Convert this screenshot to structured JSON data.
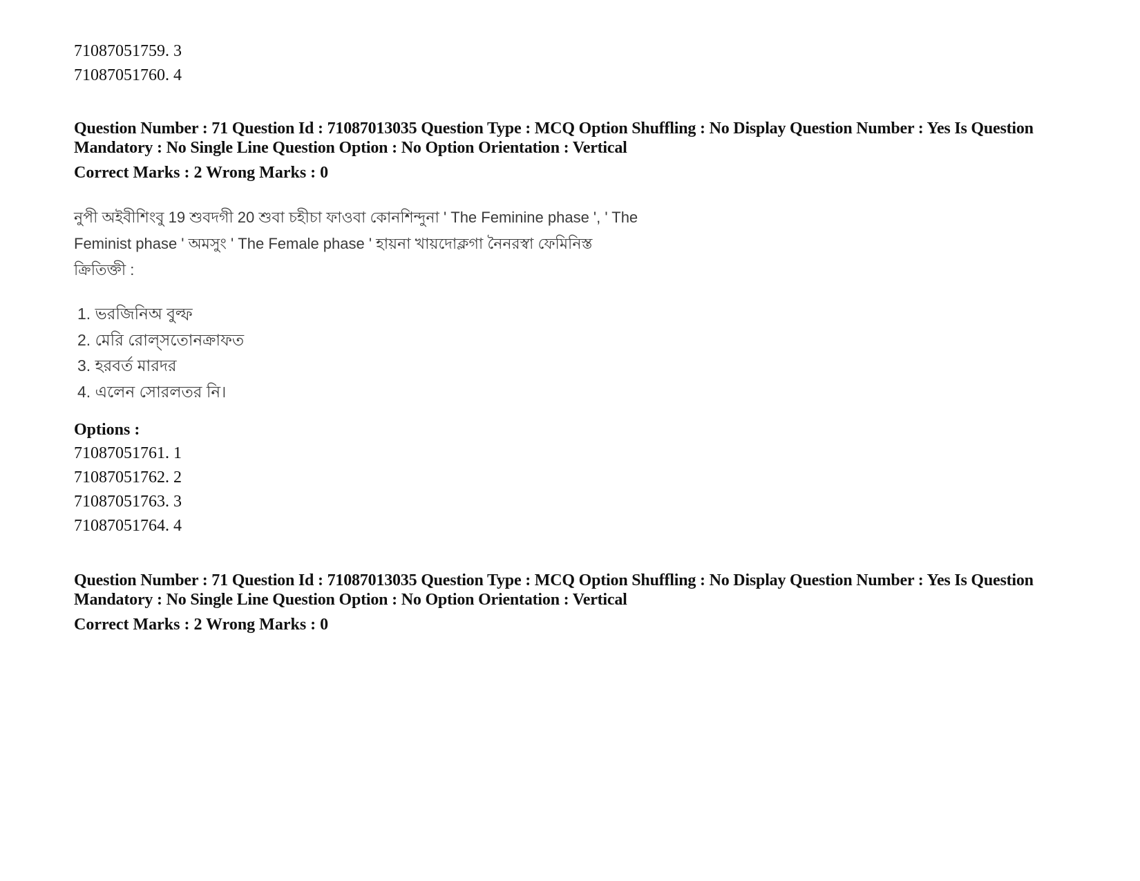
{
  "previous_options": [
    "71087051759. 3",
    "71087051760. 4"
  ],
  "question_block_1": {
    "header": "Question Number : 71 Question Id : 71087013035 Question Type : MCQ Option Shuffling : No Display Question Number : Yes Is Question Mandatory : No Single Line Question Option : No Option Orientation : Vertical",
    "marks": "Correct Marks : 2 Wrong Marks : 0",
    "passage_lines": [
      "নুপী অইবীশিংবু 19 শুবদগী 20 শুবা চহীচা ফাওবা কোনশিন্দুনা ' The Feminine phase ', ' The",
      "Feminist phase '  অমসুং ' The Female phase ' হায়না খায়দোক্লগা নৈনরস্বা ফেমিনিস্ত",
      "ক্রিতিক্তী :"
    ],
    "statements": [
      "1. ভরজিনিঅ বুল্ফ",
      "2. মেরি রোল্সতোনক্রাফত",
      "3. হরবর্ত মারদর",
      "4. এলেন সোরলতর   নি।"
    ],
    "options_label": "Options :",
    "options": [
      "71087051761. 1",
      "71087051762. 2",
      "71087051763. 3",
      "71087051764. 4"
    ]
  },
  "question_block_2": {
    "header": "Question Number : 71 Question Id : 71087013035 Question Type : MCQ Option Shuffling : No Display Question Number : Yes Is Question Mandatory : No Single Line Question Option : No Option Orientation : Vertical",
    "marks": "Correct Marks : 2 Wrong Marks : 0"
  }
}
